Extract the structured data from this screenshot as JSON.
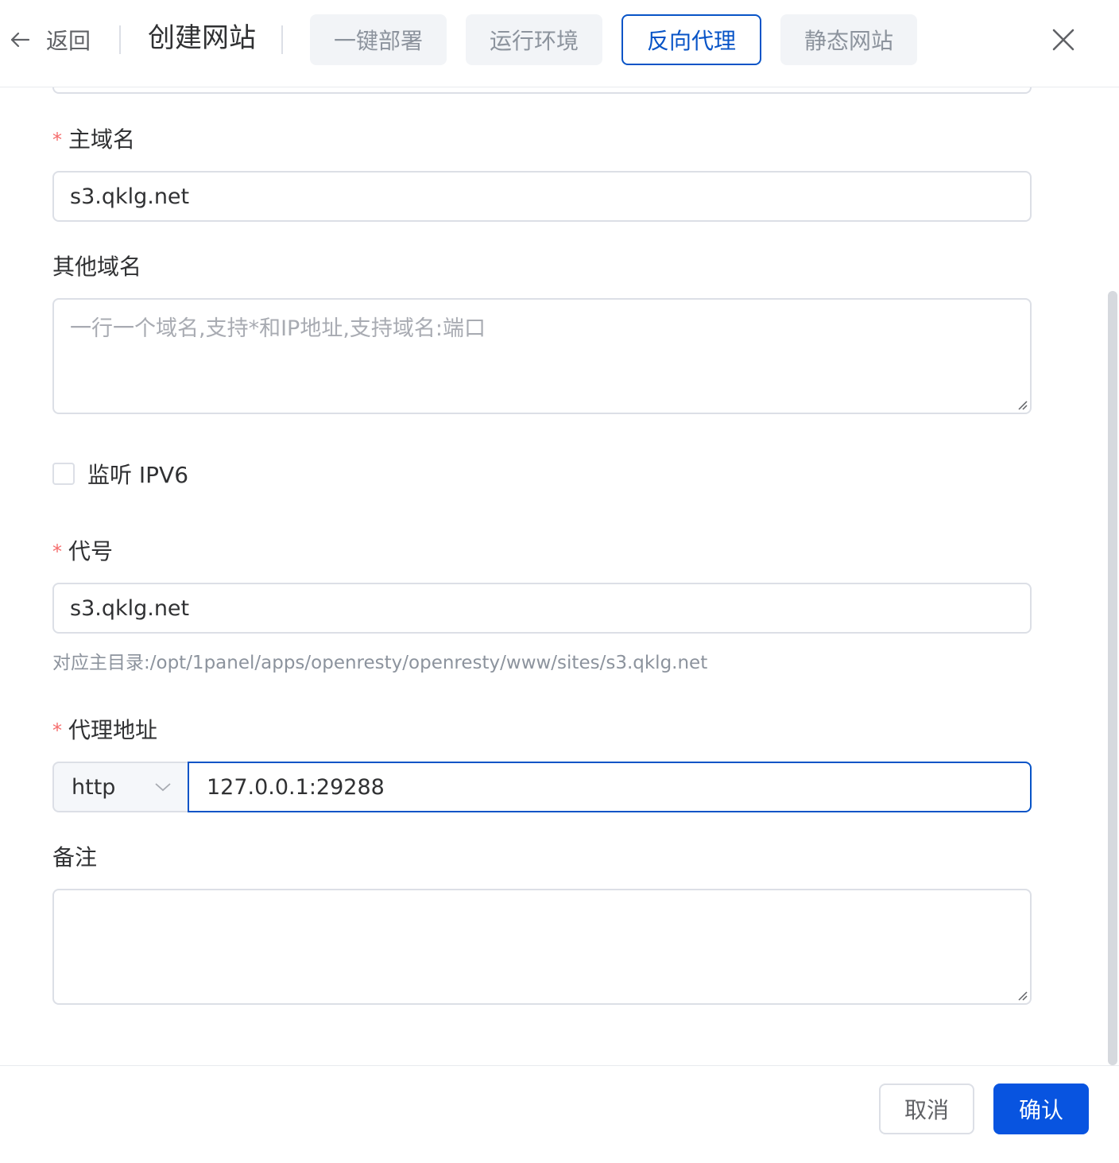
{
  "header": {
    "back_label": "返回",
    "title": "创建网站",
    "tabs": [
      {
        "label": "一键部署",
        "active": false
      },
      {
        "label": "运行环境",
        "active": false
      },
      {
        "label": "反向代理",
        "active": true
      },
      {
        "label": "静态网站",
        "active": false
      }
    ]
  },
  "form": {
    "primary_domain": {
      "label": "主域名",
      "required": true,
      "value": "s3.qklg.net"
    },
    "other_domains": {
      "label": "其他域名",
      "required": false,
      "placeholder": "一行一个域名,支持*和IP地址,支持域名:端口",
      "value": ""
    },
    "ipv6": {
      "label": "监听 IPV6",
      "checked": false
    },
    "alias": {
      "label": "代号",
      "required": true,
      "value": "s3.qklg.net",
      "hint": "对应主目录:/opt/1panel/apps/openresty/openresty/www/sites/s3.qklg.net"
    },
    "proxy": {
      "label": "代理地址",
      "required": true,
      "protocol": "http",
      "address": "127.0.0.1:29288"
    },
    "remark": {
      "label": "备注",
      "value": ""
    }
  },
  "footer": {
    "cancel_label": "取消",
    "confirm_label": "确认"
  },
  "colors": {
    "primary": "#0854c7",
    "required": "#f56c6c",
    "tab_bg": "#f2f4f7"
  }
}
